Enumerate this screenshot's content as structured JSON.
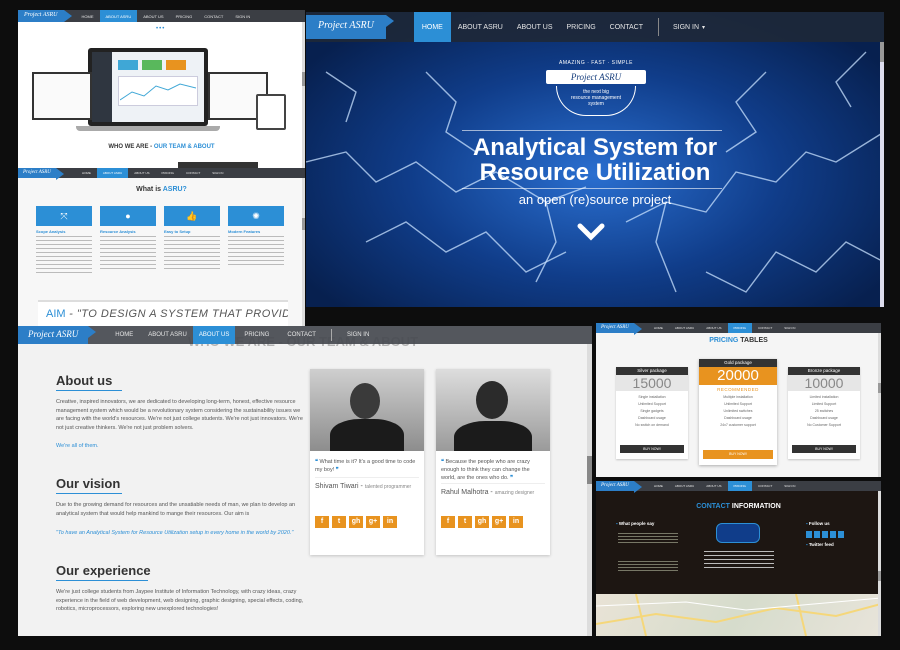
{
  "logo": "Project ASRU",
  "nav_small": [
    "HOME",
    "ABOUT ASRU",
    "ABOUT US",
    "PRICING",
    "CONTACT",
    "SIGN IN"
  ],
  "hero": {
    "nav": [
      "HOME",
      "ABOUT ASRU",
      "ABOUT US",
      "PRICING",
      "CONTACT",
      "SIGN IN"
    ],
    "badge_top": "AMAZING · FAST · SIMPLE",
    "badge_ribbon": "Project ASRU",
    "badge_lines": [
      "the next big",
      "resource management",
      "system"
    ],
    "title_line1": "Analytical System for",
    "title_line2": "Resource Utilization",
    "subtitle": "an open (re)source project"
  },
  "thumb_top": {
    "section_title_prefix": "WHO WE ARE - ",
    "section_title_highlight": "OUR TEAM & ABOUT"
  },
  "thumb_mid": {
    "title_prefix": "What is ",
    "title_highlight": "ASRU?",
    "features": [
      {
        "title": "Scope Analysis",
        "icon": "expand"
      },
      {
        "title": "Resource Analysis",
        "icon": "drop"
      },
      {
        "title": "Easy to Setup",
        "icon": "thumb"
      },
      {
        "title": "Modern Features",
        "icon": "spinner"
      }
    ],
    "aim_prefix": "AIM",
    "aim_text": " - \"TO DESIGN A SYSTEM THAT PROVIDES"
  },
  "about": {
    "nav": [
      "HOME",
      "ABOUT ASRU",
      "ABOUT US",
      "PRICING",
      "CONTACT",
      "SIGN IN"
    ],
    "overlay_title": "WHO WE ARE - OUR TEAM & ABOUT",
    "about_heading": "About us",
    "about_text": "Creative, inspired innovators, we are dedicated to developing long-term, honest, effective resource management system which would be a revolutionary system considering the sustainability issues we are facing with the world's resources. We're not just college students. We're not just innovators. We're not just creative thinkers. We're not just problem solvers.",
    "about_link": "We're all of them.",
    "vision_heading": "Our vision",
    "vision_text": "Due to the growing demand for resources and the unsatiable needs of man, we plan to develop an analytical system that would help mankind to mange their resources. Our aim is",
    "vision_quote": "\"To have an Analytical System for Resource Utilization setup in every home in the world by 2020.\"",
    "exp_heading": "Our experience",
    "exp_text": "We're just college students from Jaypee Institute of Information Technology, with crazy ideas, crazy experience in the field of web development, web designing, graphic designing, special effects, coding, robotics, microprocessors, exploring new unexplored technologies!",
    "team": [
      {
        "quote": "What time is it? It's a good time to code my boy!",
        "name": "Shivam Tiwari",
        "role": "talented programmer"
      },
      {
        "quote": "Because the people who are crazy enough to think they can change the world, are the ones who do.",
        "name": "Rahul Malhotra",
        "role": "amazing designer"
      }
    ],
    "social": [
      "f",
      "t",
      "gh",
      "g+",
      "in"
    ]
  },
  "pricing": {
    "title_prefix": "PRICING",
    "title_suffix": " TABLES",
    "packages": [
      {
        "name": "Silver package",
        "price": "15000",
        "features": [
          "Single installation",
          "Unlimited Support",
          "Single gadgets",
          "Dashboard usage",
          "No switch on demand"
        ],
        "button": "BUY NOW!"
      },
      {
        "name": "Gold package",
        "price": "20000",
        "tag": "RECOMMENDED",
        "features": [
          "Multiple installation",
          "Unlimited Support",
          "Unlimited switches",
          "Dashboard usage",
          "24x7 customer support"
        ],
        "button": "BUY NOW!"
      },
      {
        "name": "Bronze package",
        "price": "10000",
        "features": [
          "Limited installation",
          "Limited Support",
          "25 switches",
          "Dashboard usage",
          "No Customer Support"
        ],
        "button": "BUY NOW!"
      }
    ]
  },
  "contact": {
    "title_prefix": "CONTACT",
    "title_suffix": " INFORMATION",
    "left_heading": "What people say",
    "right_heading1": "Follow us",
    "right_heading2": "Twitter feed"
  },
  "colors": {
    "accent": "#2c8fd6",
    "orange": "#e8931f",
    "nav": "#3b3e44"
  }
}
